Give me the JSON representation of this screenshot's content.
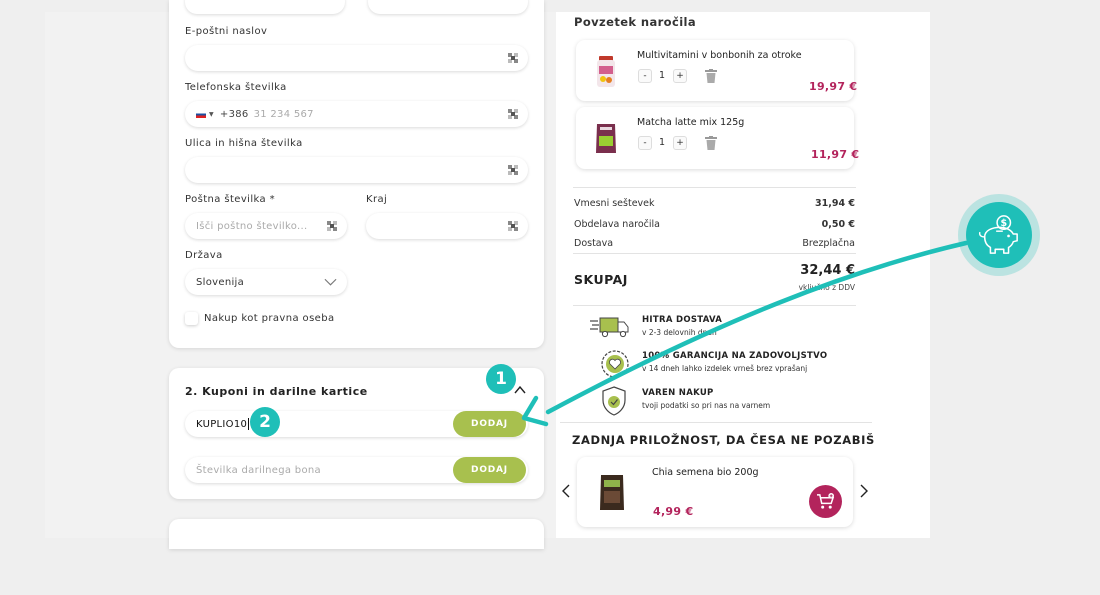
{
  "form": {
    "email_label": "E-poštni naslov",
    "phone_label": "Telefonska številka",
    "phone_prefix": "+386",
    "phone_placeholder": "31 234 567",
    "street_label": "Ulica in hišna številka",
    "postal_label": "Poštna številka *",
    "postal_placeholder": "Išči poštno številko...",
    "city_label": "Kraj",
    "country_label": "Država",
    "country_value": "Slovenija",
    "company_checkbox_label": "Nakup kot pravna oseba"
  },
  "coupons": {
    "title": "2. Kuponi in darilne kartice",
    "coupon_value": "KUPLIO10",
    "add_label": "DODAJ",
    "gift_placeholder": "Številka darilnega bona",
    "gift_add_label": "DODAJ"
  },
  "annotations": {
    "badge_1": "1",
    "badge_2": "2"
  },
  "summary": {
    "title": "Povzetek naročila",
    "items": [
      {
        "name": "Multivitamini v bonbonih za otroke",
        "qty": "1",
        "price": "19,97 €"
      },
      {
        "name": "Matcha latte mix 125g",
        "qty": "1",
        "price": "11,97 €"
      }
    ],
    "subtotal_label": "Vmesni seštevek",
    "subtotal_value": "31,94 €",
    "handling_label": "Obdelava naročila",
    "handling_value": "0,50 €",
    "shipping_label": "Dostava",
    "shipping_value": "Brezplačna",
    "total_label": "SKUPAJ",
    "total_value": "32,44 €",
    "vat_note": "vključno z DDV"
  },
  "benefits": [
    {
      "title": "HITRA DOSTAVA",
      "subtitle": "v 2-3 delovnih dneh"
    },
    {
      "title": "100% GARANCIJA NA ZADOVOLJSTVO",
      "subtitle": "v 14 dneh lahko izdelek vrneš brez vprašanj"
    },
    {
      "title": "VAREN NAKUP",
      "subtitle": "tvoji podatki so pri nas na varnem"
    }
  ],
  "last_chance": {
    "title": "ZADNJA PRILOŽNOST, DA ČESA NE POZABIŠ",
    "product_name": "Chia semena bio 200g",
    "product_price": "4,99 €"
  },
  "colors": {
    "accent_green": "#a8c04e",
    "price_red": "#b3245c",
    "teal": "#1fbfb8"
  }
}
